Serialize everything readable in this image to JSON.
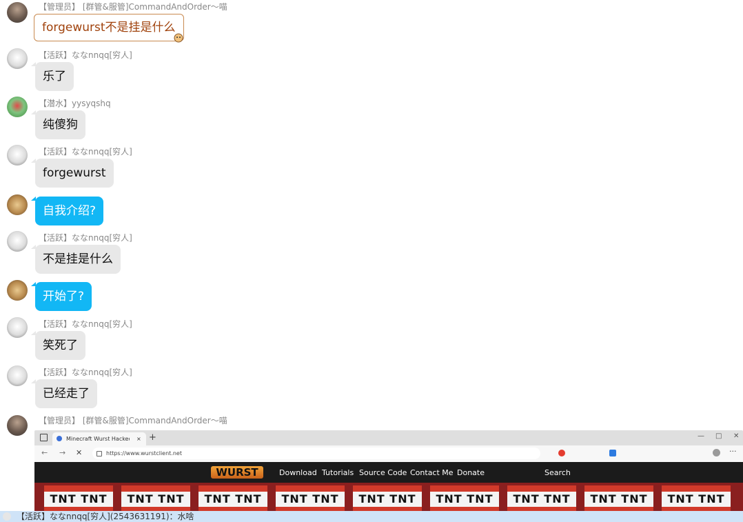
{
  "messages": [
    {
      "meta": "【管理员】 [群管&服管]CommandAndOrder～喵",
      "text": "forgewurst不是挂是什么"
    },
    {
      "meta": "【活跃】ななnnqq[穷人]",
      "text": "乐了"
    },
    {
      "meta": "【潜水】yysyqshq",
      "text": "纯傻狗"
    },
    {
      "meta": "【活跃】ななnnqq[穷人]",
      "text": "forgewurst"
    },
    {
      "text": "自我介绍?"
    },
    {
      "meta": "【活跃】ななnnqq[穷人]",
      "text": "不是挂是什么"
    },
    {
      "text": "开始了?"
    },
    {
      "meta": "【活跃】ななnnqq[穷人]",
      "text": "笑死了"
    },
    {
      "meta": "【活跃】ななnnqq[穷人]",
      "text": "已经走了"
    },
    {
      "meta": "【管理员】 [群管&服管]CommandAndOrder～喵"
    }
  ],
  "screenshot": {
    "tab_title": "Minecraft Wurst Hacked Client",
    "url": "https://www.wurstclient.net",
    "logo": "WURST",
    "nav": [
      "Download",
      "Tutorials",
      "Source Code",
      "Contact Me",
      "Donate"
    ],
    "search": "Search",
    "tnt_label": "TNT TNT"
  },
  "bottom_notice": "【活跃】ななnnqq[穷人](2543631191)：水啥"
}
